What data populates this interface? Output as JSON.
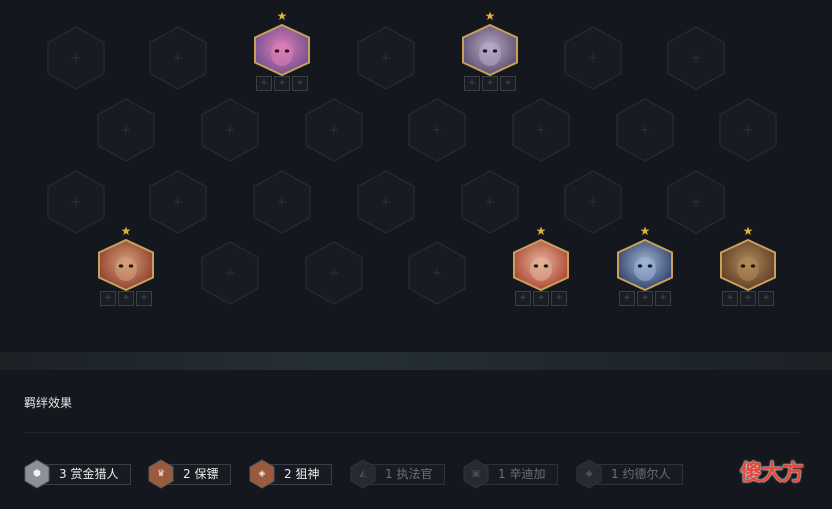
{
  "board": {
    "empty_slot_symbol": "+",
    "item_slot_symbol": "+",
    "star_symbol": "★",
    "champions": [
      {
        "name": "champion-pink-hair",
        "stars": 1,
        "colors": [
          "#6a4d8c",
          "#e07fb8"
        ]
      },
      {
        "name": "champion-white-hair",
        "stars": 1,
        "colors": [
          "#5a4a6a",
          "#b9a9c8"
        ]
      },
      {
        "name": "champion-red-hat",
        "stars": 1,
        "colors": [
          "#8a3a2a",
          "#d6a07a"
        ]
      },
      {
        "name": "champion-red-hair",
        "stars": 1,
        "colors": [
          "#a8402e",
          "#e6b59a"
        ]
      },
      {
        "name": "champion-blue-hair",
        "stars": 1,
        "colors": [
          "#2c3b63",
          "#9fb6d8"
        ]
      },
      {
        "name": "champion-brown-armor",
        "stars": 1,
        "colors": [
          "#5a3a22",
          "#b08a5a"
        ]
      }
    ]
  },
  "synergy_panel": {
    "title": "羁绊效果",
    "traits": [
      {
        "label": "3 赏金猎人",
        "active": true,
        "hex_color": "#8d9096",
        "glyph": "⬢"
      },
      {
        "label": "2 保镖",
        "active": true,
        "hex_color": "#9a5a3e",
        "glyph": "♛"
      },
      {
        "label": "2 狙神",
        "active": true,
        "hex_color": "#9a5a3e",
        "glyph": "◈"
      },
      {
        "label": "1 执法官",
        "active": false,
        "hex_color": "#262a31",
        "glyph": "◭"
      },
      {
        "label": "1 辛迪加",
        "active": false,
        "hex_color": "#262a31",
        "glyph": "▣"
      },
      {
        "label": "1 约德尔人",
        "active": false,
        "hex_color": "#262a31",
        "glyph": "◆"
      }
    ]
  },
  "watermark": "傻大方"
}
